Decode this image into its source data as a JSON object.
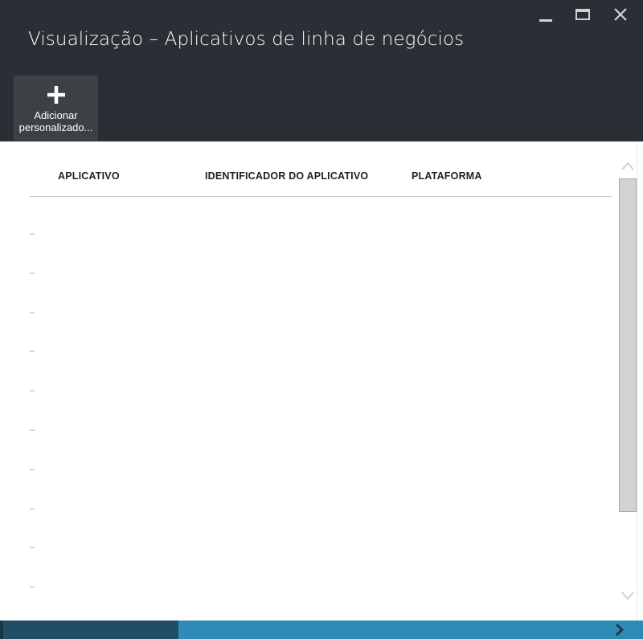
{
  "window": {
    "title": "Visualização – Aplicativos de linha de negócios",
    "controls": [
      "minimize-icon",
      "maximize-icon",
      "close-icon"
    ]
  },
  "toolbar": {
    "add_custom_label": "Adicionar\npersonalizado...",
    "add_custom_icon": "plus-icon"
  },
  "table": {
    "columns": [
      "APLICATIVO",
      "IDENTIFICADOR DO APLICATIVO",
      "PLATAFORMA"
    ],
    "rows": [
      "–",
      "–",
      "–",
      "–",
      "–",
      "–",
      "–",
      "–",
      "–",
      "–"
    ]
  },
  "colors": {
    "header_bg": "#2a2f35",
    "toolbar_button_bg": "#3c4146",
    "footer_bg": "#2f8bb6",
    "footer_dark": "#1f4e66"
  }
}
